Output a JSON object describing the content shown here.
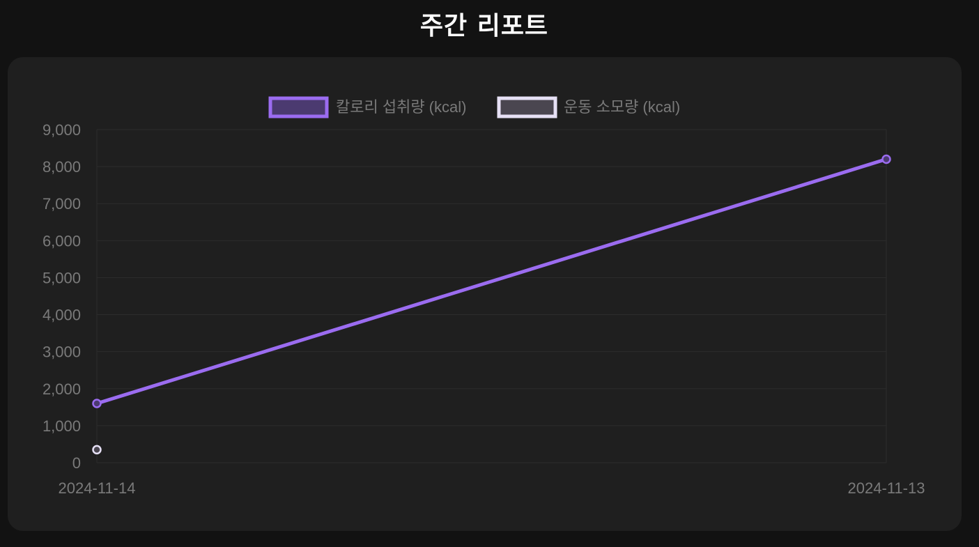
{
  "page": {
    "title": "주간 리포트"
  },
  "colors": {
    "page_background": "#121212",
    "card_background": "#1f1f1f",
    "grid": "#2c2c2c",
    "text_muted": "#7a7a7a",
    "title": "#ffffff"
  },
  "chart_data": {
    "type": "line",
    "title": "",
    "xlabel": "",
    "ylabel": "",
    "x": [
      "2024-11-14",
      "2024-11-13"
    ],
    "ylim": [
      0,
      9000
    ],
    "yticks": [
      0,
      1000,
      2000,
      3000,
      4000,
      5000,
      6000,
      7000,
      8000,
      9000
    ],
    "ytick_labels": [
      "0",
      "1,000",
      "2,000",
      "3,000",
      "4,000",
      "5,000",
      "6,000",
      "7,000",
      "8,000",
      "9,000"
    ],
    "grid": true,
    "legend_position": "top-center",
    "series": [
      {
        "name": "칼로리 섭취량 (kcal)",
        "values": [
          1600,
          8200
        ],
        "color": "#9b6cf0",
        "fill": "#4b3a70"
      },
      {
        "name": "운동 소모량 (kcal)",
        "values": [
          350,
          null
        ],
        "color": "#e6e0f5",
        "fill": "#4a4650"
      }
    ]
  }
}
